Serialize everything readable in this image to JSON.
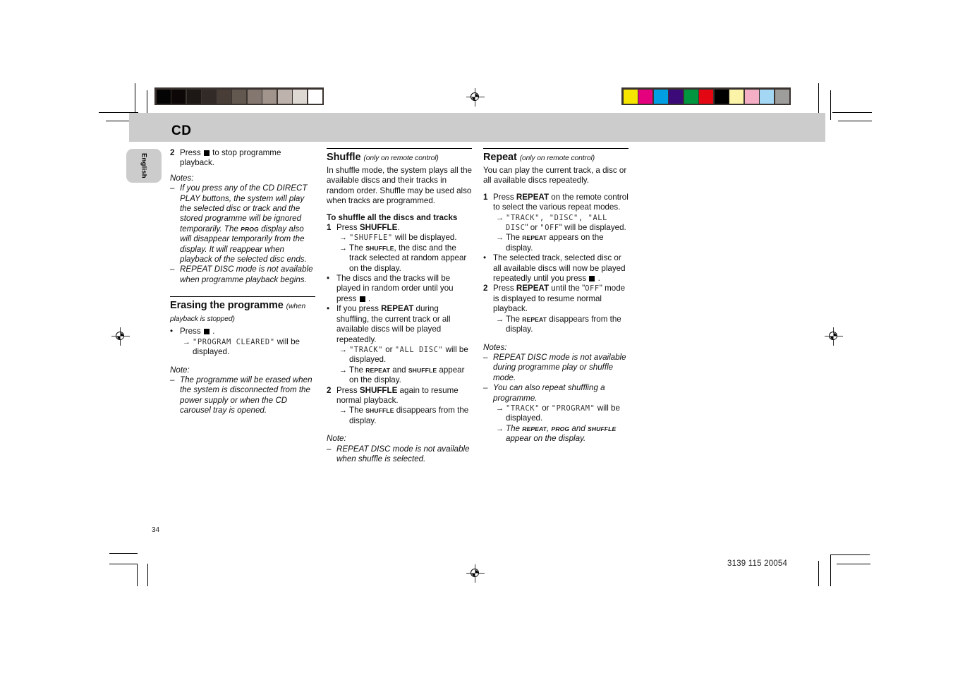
{
  "page": {
    "header_title": "CD",
    "language_tab": "English",
    "page_number": "34",
    "doc_code": "3139 115 20054",
    "colors": {
      "header_band": "#cccccc",
      "tab_bg": "#cccccc",
      "lcd_text": "#333333"
    }
  },
  "colorbar_left": {
    "name": "grayscale-control-strip",
    "swatches": [
      "#050404",
      "#0d0707",
      "#1d1715",
      "#322a26",
      "#483d37",
      "#635850",
      "#837770",
      "#a0948d",
      "#bdb2ac",
      "#ded8d3",
      "#ffffff"
    ]
  },
  "colorbar_right": {
    "name": "process-colour-control-strip",
    "swatches": [
      "#f5e500",
      "#e5007e",
      "#009fe3",
      "#3b0a78",
      "#009640",
      "#e30613",
      "#000000",
      "#faf3a8",
      "#f4aec6",
      "#a3d7f4",
      "#9d9d9c"
    ]
  },
  "column1": {
    "step2": {
      "num": "2",
      "pre": "Press",
      "post": "to stop programme playback."
    },
    "notes_label": "Notes:",
    "notes": [
      {
        "marker": "–",
        "parts": [
          "If you press any of the CD DIRECT PLAY buttons, the system will play the selected disc or track and the stored programme will be ignored temporarily. The ",
          "PROG",
          " display also will disappear temporarily from the display. It will reappear when playback of the selected disc ends."
        ]
      },
      {
        "marker": "–",
        "text": "REPEAT DISC mode is not available when programme playback begins."
      }
    ],
    "erasing": {
      "heading": "Erasing the programme",
      "qualifier": "(when playback is stopped)",
      "bullet_marker": "•",
      "bullet_pre": "Press",
      "bullet_post": ".",
      "arrow": "→",
      "display_quote_open": "\"",
      "display_text": "PROGRAM CLEARED",
      "display_quote_close": "\"",
      "display_tail": " will be displayed."
    },
    "note_label": "Note:",
    "note": {
      "marker": "–",
      "text": "The programme will be erased when the system is disconnected from the power supply or when the CD carousel tray is opened."
    }
  },
  "column2": {
    "heading": "Shuffle",
    "qualifier": "(only on remote control)",
    "intro": "In shuffle mode, the system plays all the available discs and their tracks in random order. Shuffle may be used also when tracks are programmed.",
    "subheading": "To shuffle all the discs and tracks",
    "items": [
      {
        "marker": "1",
        "type": "num",
        "pre": "Press ",
        "bold": "SHUFFLE",
        "post": "."
      },
      {
        "marker": "→",
        "type": "arrow",
        "lcd": "SHUFFLE",
        "pre_quote": "\"",
        "post_quote": "\"",
        "tail": " will be displayed."
      },
      {
        "marker": "→",
        "type": "arrow-sc",
        "pre": "The ",
        "sc": "SHUFFLE",
        "post": ", the disc and the track selected at random appear on the display."
      },
      {
        "marker": "•",
        "type": "bullet-sq",
        "pre": "The discs and the tracks will be played in random order until you press",
        "post": "."
      },
      {
        "marker": "•",
        "type": "bullet-bold",
        "pre": "If you press ",
        "bold": "REPEAT",
        "post": " during shuffling, the current track or all available discs will be played repeatedly."
      },
      {
        "marker": "→",
        "type": "arrow-two-lcd",
        "lcd1": "TRACK",
        "mid": " or ",
        "lcd2": "ALL DISC",
        "tail": " will be displayed."
      },
      {
        "marker": "→",
        "type": "arrow-two-sc",
        "pre": "The ",
        "sc1": "REPEAT",
        "mid": " and ",
        "sc2": "SHUFFLE",
        "post": " appear on the display."
      },
      {
        "marker": "2",
        "type": "num",
        "pre": "Press ",
        "bold": "SHUFFLE",
        "post": " again to resume normal playback."
      },
      {
        "marker": "→",
        "type": "arrow-sc",
        "pre": "The ",
        "sc": "SHUFFLE",
        "post": " disappears from the display."
      }
    ],
    "note_label": "Note:",
    "note": {
      "marker": "–",
      "text": "REPEAT DISC mode is not available when shuffle is selected."
    }
  },
  "column3": {
    "heading": "Repeat",
    "qualifier": "(only on remote control)",
    "intro": "You can play the current track, a disc or all available discs repeatedly.",
    "items": [
      {
        "marker": "1",
        "type": "num",
        "pre": "Press ",
        "bold": "REPEAT",
        "post": " on the remote control to select the various repeat modes."
      },
      {
        "marker": "→",
        "type": "arrow-modes",
        "lcd1": "TRACK",
        "lcd2": "DISC",
        "lcd3": "ALL DISC",
        "sep1": "\", \"",
        "sep2": "\", \"",
        "or": "\" or",
        "lcd4": "OFF",
        "tail": "\" will be displayed."
      },
      {
        "marker": "→",
        "type": "arrow-sc",
        "pre": "The ",
        "sc": "REPEAT",
        "post": " appears on the display."
      },
      {
        "marker": "•",
        "type": "bullet-sq",
        "pre": "The selected track, selected disc or all available discs will now be played repeatedly until you press",
        "post": "."
      },
      {
        "marker": "2",
        "type": "num-lcd",
        "pre": "Press ",
        "bold": "REPEAT",
        "mid": " until the \"",
        "lcd": "OFF",
        "post": "\" mode is displayed to resume normal playback."
      },
      {
        "marker": "→",
        "type": "arrow-sc",
        "pre": "The ",
        "sc": "REPEAT",
        "post": " disappears from the display."
      }
    ],
    "notes_label": "Notes:",
    "notes": [
      {
        "marker": "–",
        "text": "REPEAT DISC mode is not available during programme play or shuffle mode."
      },
      {
        "marker": "–",
        "text": "You can also repeat shuffling a programme."
      }
    ],
    "sub_items": [
      {
        "marker": "→",
        "type": "arrow-two-lcd",
        "lcd1": "TRACK",
        "mid": " or ",
        "lcd2": "PROGRAM",
        "tail": " will be displayed."
      },
      {
        "marker": "→",
        "type": "arrow-three-sc",
        "pre": "The ",
        "sc1": "REPEAT",
        "sep1": ", ",
        "sc2": "PROG",
        "sep2": " and ",
        "sc3": "SHUFFLE",
        "post": " appear on the display."
      }
    ]
  }
}
